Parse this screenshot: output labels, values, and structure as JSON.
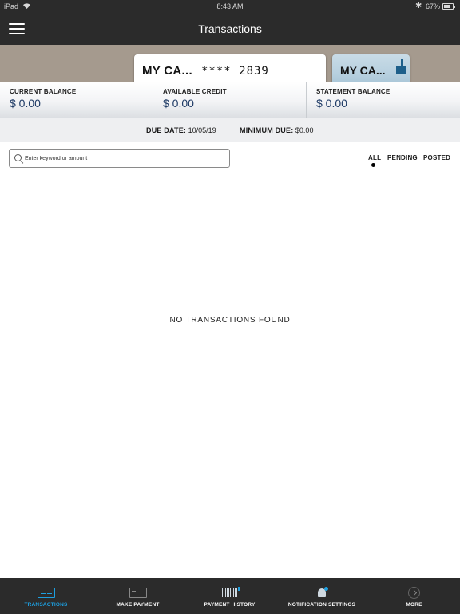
{
  "status_bar": {
    "device": "iPad",
    "time": "8:43 AM",
    "battery": "67%"
  },
  "header": {
    "title": "Transactions"
  },
  "cards": [
    {
      "name": "MY CA...",
      "masked_number": "**** 2839"
    },
    {
      "name": "MY CA..."
    }
  ],
  "balances": {
    "current": {
      "label": "CURRENT BALANCE",
      "amount": "$ 0.00"
    },
    "available": {
      "label": "AVAILABLE CREDIT",
      "amount": "$ 0.00"
    },
    "statement": {
      "label": "STATEMENT BALANCE",
      "amount": "$ 0.00"
    }
  },
  "due": {
    "due_date_label": "DUE DATE:",
    "due_date_value": "10/05/19",
    "minimum_due_label": "MINIMUM DUE:",
    "minimum_due_value": "$0.00"
  },
  "search": {
    "placeholder": "Enter keyword or amount"
  },
  "filters": {
    "items": [
      "ALL",
      "PENDING",
      "POSTED"
    ],
    "selected": "ALL"
  },
  "empty_state": {
    "message": "NO TRANSACTIONS FOUND"
  },
  "tab_bar": {
    "items": [
      {
        "label": "TRANSACTIONS",
        "icon": "card-list-icon",
        "active": true
      },
      {
        "label": "MAKE PAYMENT",
        "icon": "card-icon",
        "active": false
      },
      {
        "label": "PAYMENT HISTORY",
        "icon": "history-icon",
        "active": false
      },
      {
        "label": "NOTIFICATION SETTINGS",
        "icon": "bell-icon",
        "active": false
      },
      {
        "label": "MORE",
        "icon": "more-icon",
        "active": false
      }
    ],
    "active_color": "#1d9fe0"
  },
  "colors": {
    "bar_background": "#2b2b2b",
    "card_strip": "#a59a8e",
    "amount_text": "#1f3b66",
    "accent": "#1d9fe0"
  }
}
